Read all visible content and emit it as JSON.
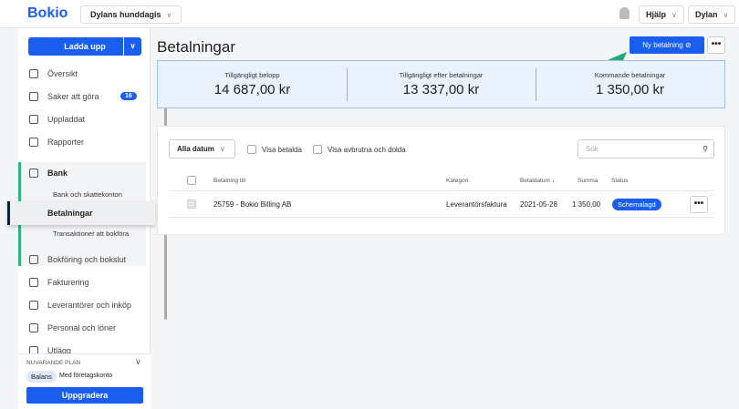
{
  "header": {
    "logo": "Bokio",
    "company": "Dylans hunddagis",
    "help": "Hjälp",
    "user": "Dylan"
  },
  "sidebar": {
    "upload": "Ladda upp",
    "items": [
      {
        "label": "Översikt"
      },
      {
        "label": "Saker att göra",
        "badge": "16"
      },
      {
        "label": "Uppladdat"
      },
      {
        "label": "Rapporter"
      },
      {
        "label": "Bank"
      },
      {
        "label": "Bokföring och bokslut"
      },
      {
        "label": "Fakturering"
      },
      {
        "label": "Leverantörer och inköp"
      },
      {
        "label": "Personal och löner"
      },
      {
        "label": "Utlägg"
      }
    ],
    "bank_sub": [
      "Bank och skattekonton",
      "Betalningar",
      "Transaktioner att bokföra"
    ],
    "plan": {
      "title": "NUVARANDE PLAN",
      "badge": "Balans",
      "desc": "Med företagskonto",
      "upgrade": "Uppgradera"
    }
  },
  "main": {
    "title": "Betalningar",
    "new_payment": "Ny betalning",
    "more": "•••",
    "stats": [
      {
        "label": "Tillgängligt belopp",
        "value": "14 687,00 kr"
      },
      {
        "label": "Tillgängligt efter betalningar",
        "value": "13 337,00 kr"
      },
      {
        "label": "Kommande betalningar",
        "value": "1 350,00 kr"
      }
    ],
    "filters": {
      "date": "Alla datum",
      "show_paid": "Visa betalda",
      "show_cancelled": "Visa avbrutna och dolda",
      "search_placeholder": "Sök"
    },
    "columns": [
      "Betalning till",
      "Kategori",
      "Betaldatum ↓",
      "Summa",
      "Status"
    ],
    "rows": [
      {
        "to": "25759 - Bokio Billing AB",
        "category": "Leverantörsfaktura",
        "date": "2021-05-28",
        "sum": "1 350,00",
        "status": "Schemalagd"
      }
    ]
  },
  "colors": {
    "accent": "#1a5ef0",
    "green": "#2fb67c"
  }
}
